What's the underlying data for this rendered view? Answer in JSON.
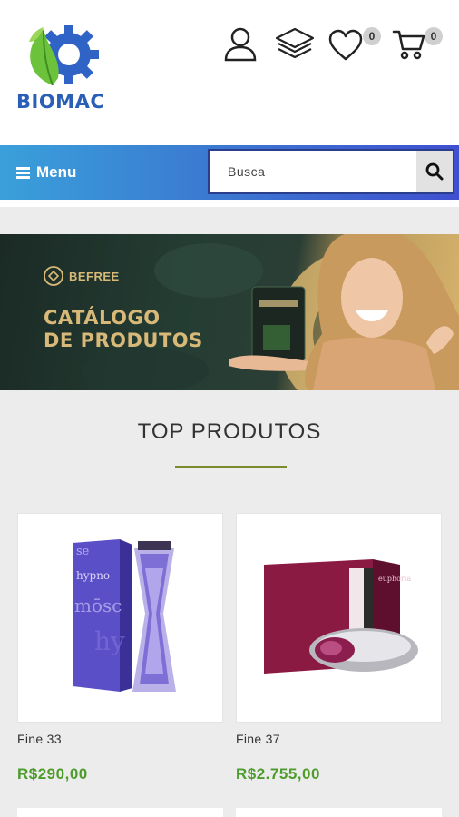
{
  "brand": {
    "name": "BIOMAC"
  },
  "header": {
    "wishlist_count": "0",
    "cart_count": "0"
  },
  "nav": {
    "menu_label": "Menu",
    "search_placeholder": "Busca"
  },
  "banner": {
    "brand": "BEFREE",
    "title_line1": "CATÁLOGO",
    "title_line2": "DE PRODUTOS"
  },
  "section": {
    "title": "TOP PRODUTOS"
  },
  "products": [
    {
      "name": "Fine 33",
      "price": "R$290,00"
    },
    {
      "name": "Fine 37",
      "price": "R$2.755,00"
    }
  ],
  "colors": {
    "brand_blue": "#2a5fb8",
    "price_green": "#4e9c2b",
    "accent_line": "#7b8c2f"
  }
}
